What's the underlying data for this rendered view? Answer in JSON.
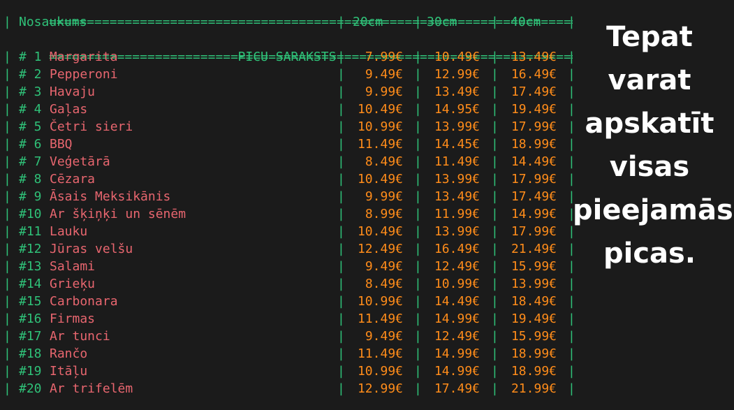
{
  "title": "PICU SARAKSTS",
  "header": {
    "name": "Nosaukums",
    "sizes": [
      "20cm",
      "30cm",
      "40cm"
    ]
  },
  "pizzas": [
    {
      "num": "# 1",
      "name": "Margarita",
      "prices": [
        "7.99€",
        "10.49€",
        "13.49€"
      ]
    },
    {
      "num": "# 2",
      "name": "Pepperoni",
      "prices": [
        "9.49€",
        "12.99€",
        "16.49€"
      ]
    },
    {
      "num": "# 3",
      "name": "Havaju",
      "prices": [
        "9.99€",
        "13.49€",
        "17.49€"
      ]
    },
    {
      "num": "# 4",
      "name": "Gaļas",
      "prices": [
        "10.49€",
        "14.95€",
        "19.49€"
      ]
    },
    {
      "num": "# 5",
      "name": "Četri sieri",
      "prices": [
        "10.99€",
        "13.99€",
        "17.99€"
      ]
    },
    {
      "num": "# 6",
      "name": "BBQ",
      "prices": [
        "11.49€",
        "14.45€",
        "18.99€"
      ]
    },
    {
      "num": "# 7",
      "name": "Veģetārā",
      "prices": [
        "8.49€",
        "11.49€",
        "14.49€"
      ]
    },
    {
      "num": "# 8",
      "name": "Cēzara",
      "prices": [
        "10.49€",
        "13.99€",
        "17.99€"
      ]
    },
    {
      "num": "# 9",
      "name": "Āsais Meksikānis",
      "prices": [
        "9.99€",
        "13.49€",
        "17.49€"
      ]
    },
    {
      "num": "#10",
      "name": "Ar šķiņķi un sēnēm",
      "prices": [
        "8.99€",
        "11.99€",
        "14.99€"
      ]
    },
    {
      "num": "#11",
      "name": "Lauku",
      "prices": [
        "10.49€",
        "13.99€",
        "17.99€"
      ]
    },
    {
      "num": "#12",
      "name": "Jūras velšu",
      "prices": [
        "12.49€",
        "16.49€",
        "21.49€"
      ]
    },
    {
      "num": "#13",
      "name": "Salami",
      "prices": [
        "9.49€",
        "12.49€",
        "15.99€"
      ]
    },
    {
      "num": "#14",
      "name": "Grieķu",
      "prices": [
        "8.49€",
        "10.99€",
        "13.99€"
      ]
    },
    {
      "num": "#15",
      "name": "Carbonara",
      "prices": [
        "10.99€",
        "14.49€",
        "18.49€"
      ]
    },
    {
      "num": "#16",
      "name": "Firmas",
      "prices": [
        "11.49€",
        "14.99€",
        "19.49€"
      ]
    },
    {
      "num": "#17",
      "name": "Ar tunci",
      "prices": [
        "9.49€",
        "12.49€",
        "15.99€"
      ]
    },
    {
      "num": "#18",
      "name": "Rančo",
      "prices": [
        "11.49€",
        "14.99€",
        "18.99€"
      ]
    },
    {
      "num": "#19",
      "name": "Itāļu",
      "prices": [
        "10.99€",
        "14.99€",
        "18.99€"
      ]
    },
    {
      "num": "#20",
      "name": "Ar trifelēm",
      "prices": [
        "12.99€",
        "17.49€",
        "21.99€"
      ]
    }
  ],
  "caption": {
    "lines": [
      "Tepat",
      "varat",
      "apskatīt",
      "visas",
      "pieejamās",
      "picas."
    ]
  },
  "colors": {
    "background": "#1b1b1b",
    "frame": "#2fc178",
    "name": "#e8666f",
    "price": "#ff8c1a",
    "caption": "#ffffff"
  }
}
